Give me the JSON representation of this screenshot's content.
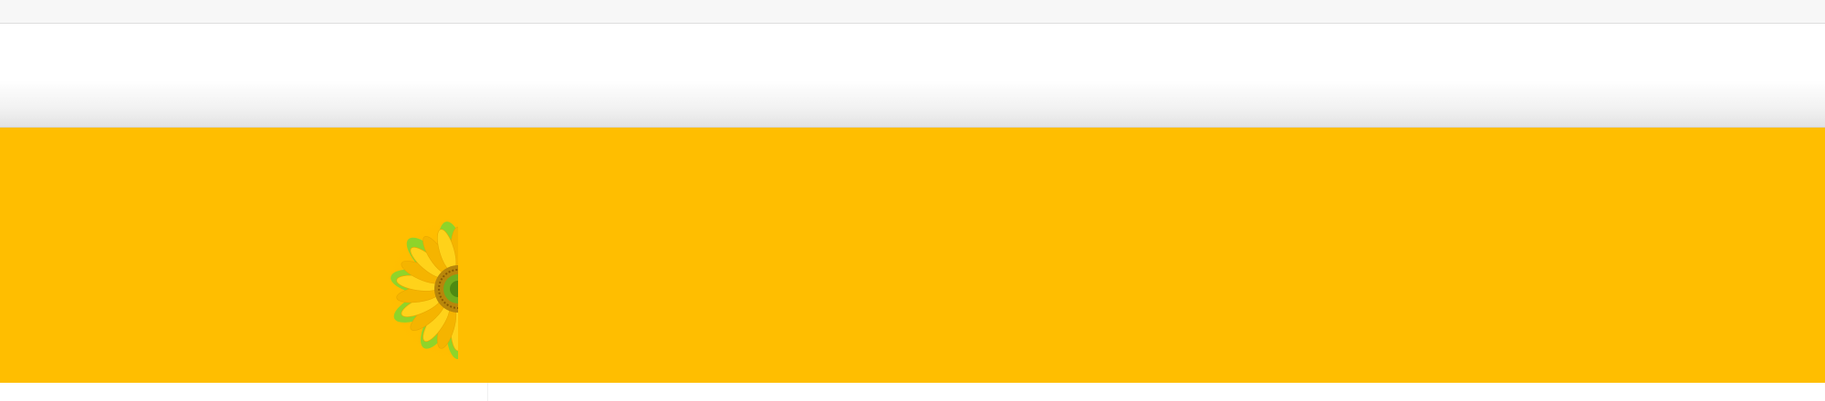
{
  "colors": {
    "top_strip": "#f7f7f7",
    "header": "#ffffff",
    "banner": "#ffbe00",
    "petal": "#ffd21a",
    "petal_dark": "#f5b400",
    "leaf": "#8fd42a",
    "flower_center": "#b8860b"
  },
  "hero": {
    "image_icon": "sunflower-icon"
  }
}
